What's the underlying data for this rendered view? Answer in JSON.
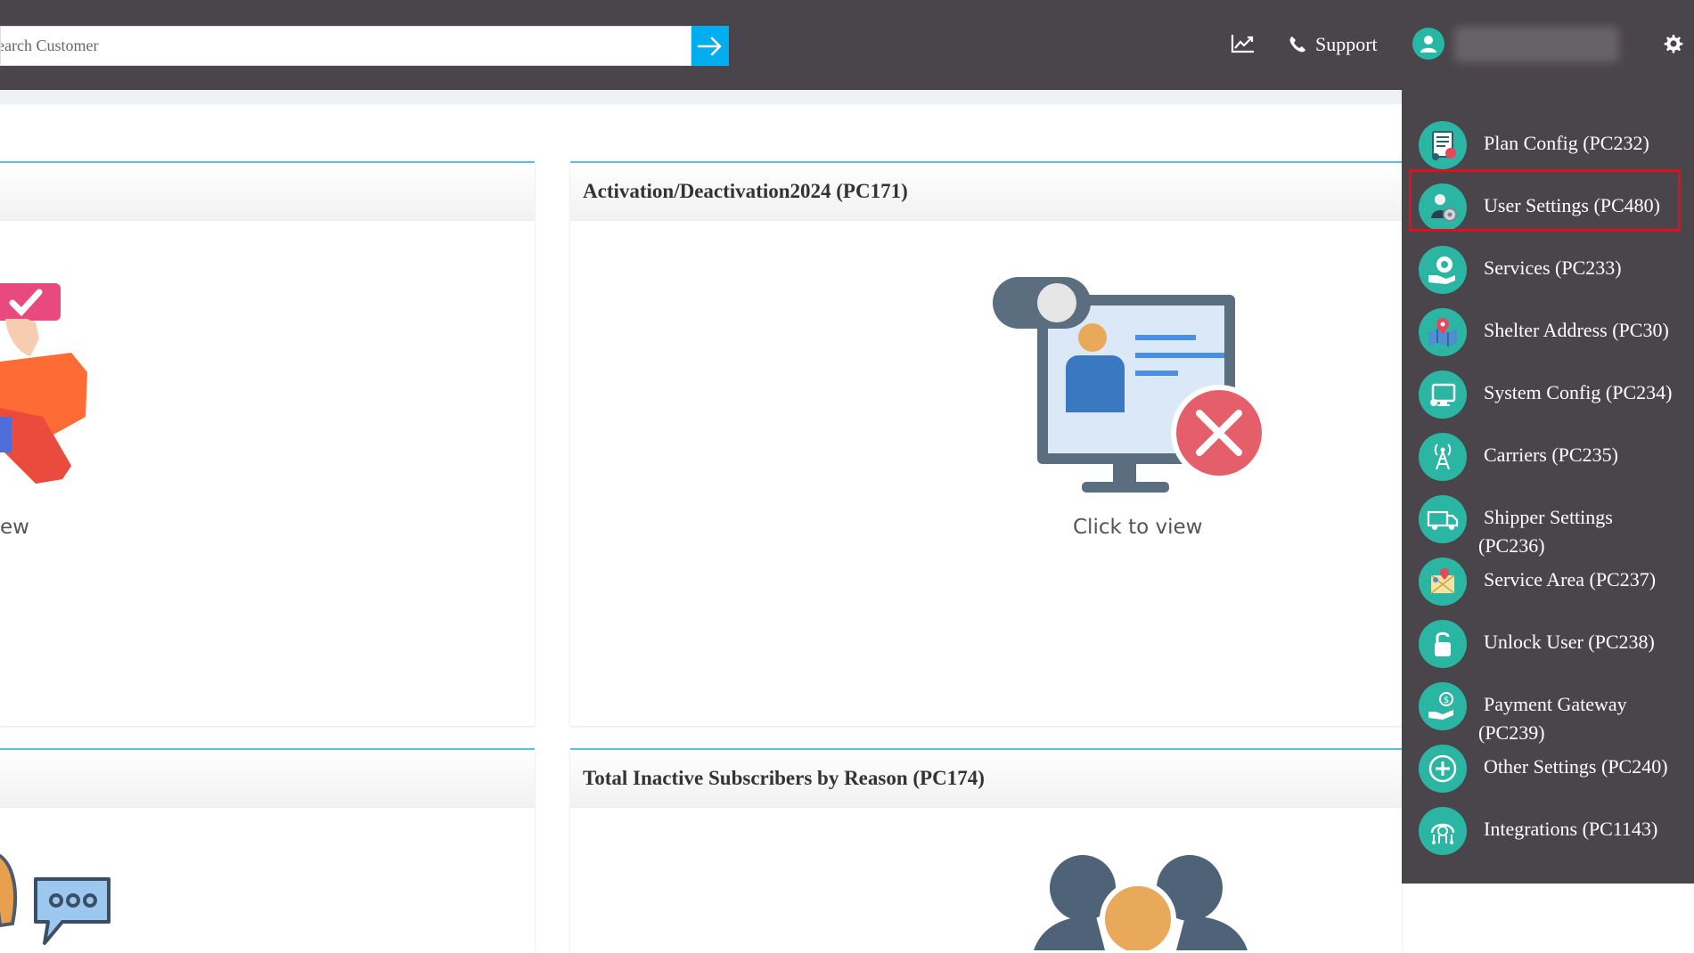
{
  "header": {
    "search_placeholder": "earch Customer",
    "support_label": "Support"
  },
  "cards": [
    {
      "title": "",
      "cta": "ew"
    },
    {
      "title": "Activation/Deactivation2024 (PC171)",
      "cta": "Click to view"
    },
    {
      "title": ""
    },
    {
      "title": "Total Inactive Subscribers by Reason (PC174)"
    }
  ],
  "menu": {
    "items": [
      {
        "label": "Plan Config (PC232)",
        "icon": "plan-config-icon"
      },
      {
        "label": "User Settings (PC480)",
        "icon": "user-settings-icon",
        "highlighted": true
      },
      {
        "label": "Services (PC233)",
        "icon": "services-icon"
      },
      {
        "label": "Shelter Address (PC30)",
        "icon": "shelter-address-icon"
      },
      {
        "label": "System Config (PC234)",
        "icon": "system-config-icon"
      },
      {
        "label": "Carriers (PC235)",
        "icon": "carriers-icon"
      },
      {
        "label": "Shipper Settings (PC236)",
        "icon": "shipper-settings-icon"
      },
      {
        "label": "Service Area (PC237)",
        "icon": "service-area-icon"
      },
      {
        "label": "Unlock User (PC238)",
        "icon": "unlock-user-icon"
      },
      {
        "label": "Payment Gateway (PC239)",
        "icon": "payment-gateway-icon"
      },
      {
        "label": "Other Settings (PC240)",
        "icon": "other-settings-icon"
      },
      {
        "label": "Integrations (PC1143)",
        "icon": "integrations-icon"
      }
    ]
  },
  "colors": {
    "topbar": "#4a454b",
    "accent": "#00aeef",
    "menu_icon": "#2bb6a3",
    "highlight": "#e0101a"
  }
}
